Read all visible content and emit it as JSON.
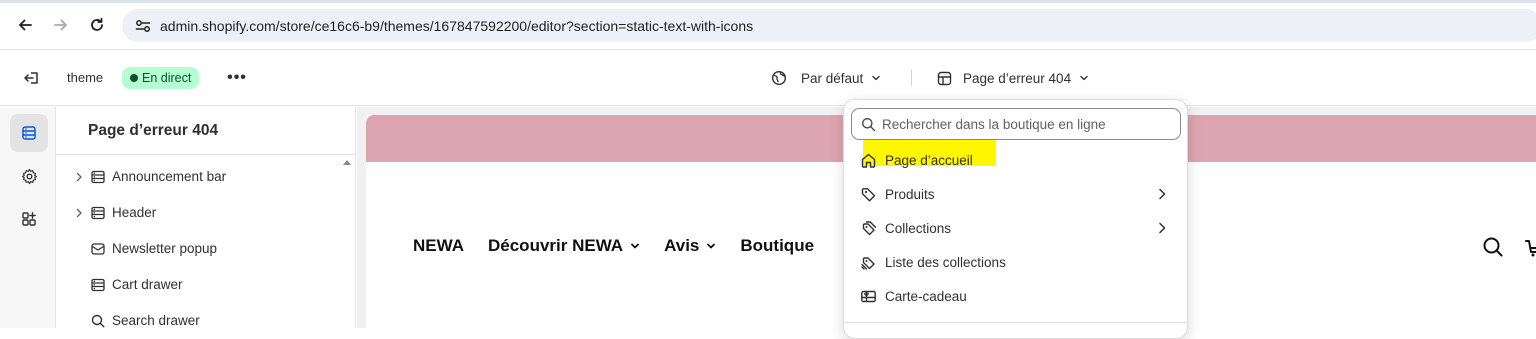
{
  "browser": {
    "url": "admin.shopify.com/store/ce16c6-b9/themes/167847592200/editor?section=static-text-with-icons"
  },
  "topbar": {
    "theme_name": "theme",
    "status_badge": "En direct",
    "more_label": "•••",
    "theme_selector": "Par défaut",
    "page_selector": "Page d’erreur 404"
  },
  "panel": {
    "title": "Page d’erreur 404",
    "items": [
      {
        "label": "Announcement bar",
        "icon": "section-icon",
        "expandable": true
      },
      {
        "label": "Header",
        "icon": "section-icon",
        "expandable": true
      },
      {
        "label": "Newsletter popup",
        "icon": "email-icon",
        "expandable": false
      },
      {
        "label": "Cart drawer",
        "icon": "section-icon",
        "expandable": false
      },
      {
        "label": "Search drawer",
        "icon": "search-icon",
        "expandable": false
      }
    ]
  },
  "preview": {
    "announcement_color": "#dca5b1",
    "nav": [
      {
        "label": "NEWA",
        "dropdown": false
      },
      {
        "label": "Découvrir NEWA",
        "dropdown": true
      },
      {
        "label": "Avis",
        "dropdown": true
      },
      {
        "label": "Boutique",
        "dropdown": false
      }
    ]
  },
  "dropdown": {
    "search_placeholder": "Rechercher dans la boutique en ligne",
    "highlight_color": "#fff700",
    "items": [
      {
        "label": "Page d’accueil",
        "icon": "home-icon",
        "has_submenu": false,
        "highlighted": true
      },
      {
        "label": "Produits",
        "icon": "tag-icon",
        "has_submenu": true,
        "highlighted": false
      },
      {
        "label": "Collections",
        "icon": "collection-icon",
        "has_submenu": true,
        "highlighted": false
      },
      {
        "label": "Liste des collections",
        "icon": "collection-list-icon",
        "has_submenu": false,
        "highlighted": false
      },
      {
        "label": "Carte-cadeau",
        "icon": "gift-card-icon",
        "has_submenu": false,
        "highlighted": false
      }
    ]
  }
}
